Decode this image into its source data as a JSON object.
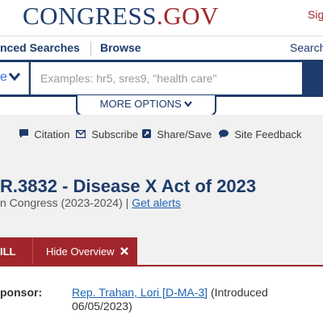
{
  "header": {
    "logo_part1": "CONGRESS",
    "logo_dot": ".",
    "logo_part2": "GOV",
    "sign_in": "Sig"
  },
  "nav": {
    "advanced_searches": "nced Searches",
    "browse": "Browse",
    "search": "Search"
  },
  "search": {
    "scope_glyph": "e",
    "placeholder": "Examples: hr5, sres9, \"health care\"",
    "more_options": "MORE OPTIONS"
  },
  "tools": {
    "citation": "Citation",
    "subscribe": "Subscribe",
    "share_save": "Share/Save",
    "site_feedback": "Site Feedback"
  },
  "bill": {
    "title": "R.3832 - Disease X Act of 2023",
    "congress": "n Congress (2023-2024)",
    "separator": "|",
    "get_alerts": "Get alerts"
  },
  "tabs": {
    "bill": "ILL",
    "hide_overview": "Hide Overview"
  },
  "overview": {
    "sponsor_label": "ponsor:",
    "sponsor_name": "Rep. Trahan, Lori [D-MA-3]",
    "sponsor_intro": "(Introduced 06/05/2023)"
  },
  "colors": {
    "navy": "#1d3b6b",
    "congress_red": "#a1262b",
    "link_blue": "#1d64b5",
    "tools_bg": "#f1f1f1"
  }
}
